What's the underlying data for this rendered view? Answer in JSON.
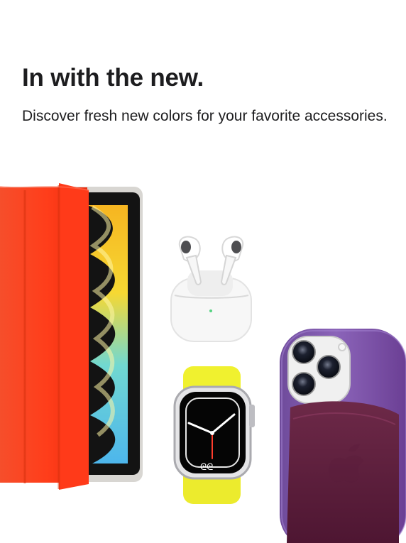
{
  "hero": {
    "headline": "In with the new.",
    "subhead": "Discover fresh new colors for your favorite accessories."
  },
  "products": [
    {
      "icon": "ipad-smart-folio-icon",
      "color": "#f53a1f"
    },
    {
      "icon": "airpods-pro-icon",
      "color": "#f5f5f7"
    },
    {
      "icon": "apple-watch-icon",
      "color": "#e9e83b"
    },
    {
      "icon": "iphone-leather-case-icon",
      "color": "#8d64b8"
    }
  ],
  "colors": {
    "text": "#1d1d1f",
    "background": "#ffffff",
    "ipad_folio": "#f53a1f",
    "watch_band": "#e9e83b",
    "iphone_case": "#8d64b8",
    "wallet": "#742b48"
  }
}
